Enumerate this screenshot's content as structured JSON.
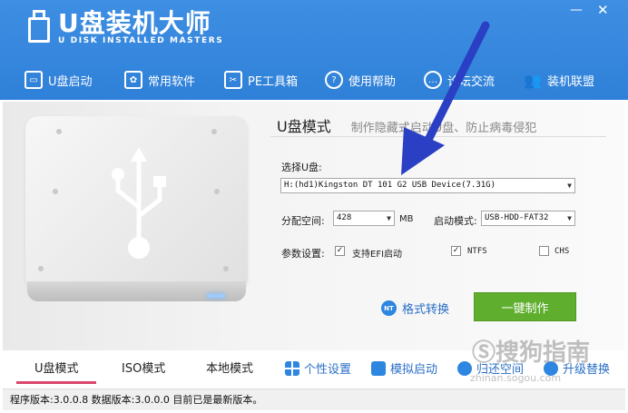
{
  "app": {
    "title": "U盘装机大师",
    "subtitle": "U DISK INSTALLED MASTERS"
  },
  "window_controls": {
    "minimize": "—",
    "close": "✕"
  },
  "nav": [
    {
      "label": "U盘启动",
      "icon": "usb-drive-icon"
    },
    {
      "label": "常用软件",
      "icon": "apps-icon"
    },
    {
      "label": "PE工具箱",
      "icon": "toolbox-icon"
    },
    {
      "label": "使用帮助",
      "icon": "help-icon"
    },
    {
      "label": "论坛交流",
      "icon": "forum-icon"
    },
    {
      "label": "装机联盟",
      "icon": "users-icon"
    }
  ],
  "main": {
    "mode_title": "U盘模式",
    "mode_sub": "制作隐藏式启动U盘、防止病毒侵犯",
    "select_disk_label": "选择U盘:",
    "select_disk_value": "H:(hd1)Kingston DT 101 G2 USB Device(7.31G)",
    "alloc_label": "分配空间:",
    "alloc_value": "428",
    "alloc_unit": "MB",
    "boot_mode_label": "启动模式:",
    "boot_mode_value": "USB-HDD-FAT32",
    "params_label": "参数设置:",
    "opt_efi": {
      "label": "支持EFI启动",
      "checked": true
    },
    "opt_ntfs": {
      "label": "NTFS",
      "checked": true
    },
    "opt_chs": {
      "label": "CHS",
      "checked": false
    },
    "format_convert": "格式转换",
    "format_icon_text": "NT",
    "make_button": "一键制作"
  },
  "tabs": [
    {
      "label": "U盘模式",
      "active": true
    },
    {
      "label": "ISO模式",
      "active": false
    },
    {
      "label": "本地模式",
      "active": false
    }
  ],
  "tools": [
    {
      "label": "个性设置",
      "icon": "grid-icon"
    },
    {
      "label": "模拟启动",
      "icon": "monitor-icon"
    },
    {
      "label": "归还空间",
      "icon": "refresh-icon"
    },
    {
      "label": "升级替换",
      "icon": "download-icon"
    }
  ],
  "status": {
    "text": "程序版本:3.0.0.8  数据版本:3.0.0.0 目前已是最新版本。"
  },
  "watermark": {
    "main": "Ⓢ搜狗指南",
    "url": "zhinan.sogou.com"
  },
  "colors": {
    "header_blue": "#3e8fe3",
    "make_green": "#5fae2e",
    "tab_active": "#d9486a",
    "link_blue": "#2a6fc7",
    "arrow_blue": "#2a3fc4"
  }
}
